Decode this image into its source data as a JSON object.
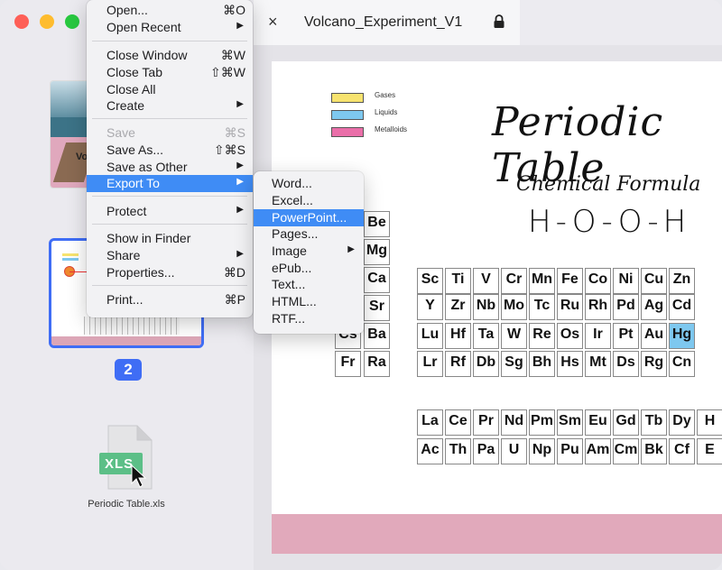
{
  "tab": {
    "title": "Volcano_Experiment_V1",
    "close_glyph": "×"
  },
  "sidebar": {
    "page_badge": "2",
    "file_label": "Periodic Table.xls",
    "file_icon_text": "XLS",
    "thumb1_text": "Vo"
  },
  "file_menu": {
    "items": [
      {
        "label": "Open...",
        "shortcut": "⌘O",
        "state": "normal"
      },
      {
        "label": "Open Recent",
        "arrow": "▶",
        "state": "normal"
      },
      {
        "label": "Close Window",
        "shortcut": "⌘W",
        "state": "normal"
      },
      {
        "label": "Close Tab",
        "shortcut": "⇧⌘W",
        "state": "normal"
      },
      {
        "label": "Close All",
        "state": "normal"
      },
      {
        "label": "Create",
        "arrow": "▶",
        "state": "normal"
      },
      {
        "label": "Save",
        "shortcut": "⌘S",
        "state": "disabled"
      },
      {
        "label": "Save As...",
        "shortcut": "⇧⌘S",
        "state": "normal"
      },
      {
        "label": "Save as Other",
        "arrow": "▶",
        "state": "normal"
      },
      {
        "label": "Export To",
        "arrow": "▶",
        "state": "selected"
      },
      {
        "label": "Protect",
        "arrow": "▶",
        "state": "normal"
      },
      {
        "label": "Show in Finder",
        "state": "normal"
      },
      {
        "label": "Share",
        "arrow": "▶",
        "state": "normal"
      },
      {
        "label": "Properties...",
        "shortcut": "⌘D",
        "state": "normal"
      },
      {
        "label": "Print...",
        "shortcut": "⌘P",
        "state": "normal"
      }
    ]
  },
  "export_menu": {
    "items": [
      {
        "label": "Word...",
        "state": "normal"
      },
      {
        "label": "Excel...",
        "state": "normal"
      },
      {
        "label": "PowerPoint...",
        "state": "selected"
      },
      {
        "label": "Pages...",
        "state": "normal"
      },
      {
        "label": "Image",
        "arrow": "▶",
        "state": "normal"
      },
      {
        "label": "ePub...",
        "state": "normal"
      },
      {
        "label": "Text...",
        "state": "normal"
      },
      {
        "label": "HTML...",
        "state": "normal"
      },
      {
        "label": "RTF...",
        "state": "normal"
      }
    ]
  },
  "document": {
    "title": "Periodic Table",
    "subtitle": "Chemical Formula",
    "formula": "H-O-O-H",
    "legend": [
      {
        "label": "Gases",
        "color": "#f7e36f"
      },
      {
        "label": "Liquids",
        "color": "#7ec8ef"
      },
      {
        "label": "Metalloids",
        "color": "#ea6fa9"
      }
    ],
    "left_block": [
      [
        "",
        "Be"
      ],
      [
        "",
        "Mg"
      ],
      [
        "",
        "Ca"
      ],
      [
        "",
        "Sr"
      ],
      [
        "Cs",
        "Ba"
      ],
      [
        "Fr",
        "Ra"
      ]
    ],
    "d_block": [
      [
        "Sc",
        "Ti",
        "V",
        "Cr",
        "Mn",
        "Fe",
        "Co",
        "Ni",
        "Cu",
        "Zn"
      ],
      [
        "Y",
        "Zr",
        "Nb",
        "Mo",
        "Tc",
        "Ru",
        "Rh",
        "Pd",
        "Ag",
        "Cd"
      ],
      [
        "Lu",
        "Hf",
        "Ta",
        "W",
        "Re",
        "Os",
        "Ir",
        "Pt",
        "Au",
        "Hg"
      ],
      [
        "Lr",
        "Rf",
        "Db",
        "Sg",
        "Bh",
        "Hs",
        "Mt",
        "Ds",
        "Rg",
        "Cn"
      ]
    ],
    "f_block": [
      [
        "La",
        "Ce",
        "Pr",
        "Nd",
        "Pm",
        "Sm",
        "Eu",
        "Gd",
        "Tb",
        "Dy",
        "H"
      ],
      [
        "Ac",
        "Th",
        "Pa",
        "U",
        "Np",
        "Pu",
        "Am",
        "Cm",
        "Bk",
        "Cf",
        "E"
      ]
    ],
    "highlighted": "Hg"
  },
  "colors": {
    "accent": "#3f6df5",
    "menu_selection": "#3f8cf5",
    "liquid_highlight": "#7ec8ef",
    "pink_band": "#e1a9bb"
  }
}
